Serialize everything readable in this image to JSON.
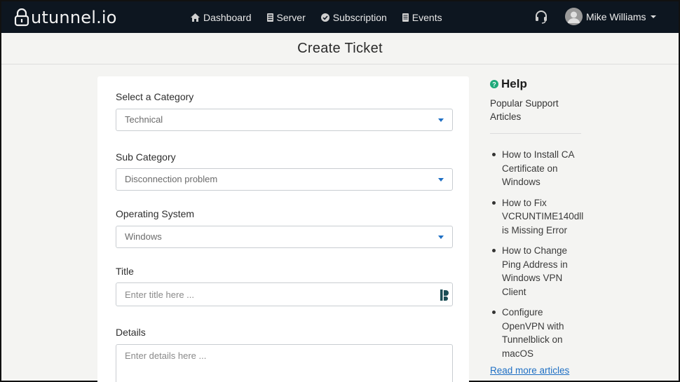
{
  "brand": {
    "logo_text": "utunnel.io"
  },
  "nav": {
    "items": [
      {
        "label": "Dashboard",
        "icon": "home-icon"
      },
      {
        "label": "Server",
        "icon": "server-icon"
      },
      {
        "label": "Subscription",
        "icon": "check-circle-icon"
      },
      {
        "label": "Events",
        "icon": "list-icon"
      }
    ]
  },
  "user": {
    "name": "Mike Williams"
  },
  "page": {
    "title": "Create Ticket"
  },
  "form": {
    "category": {
      "label": "Select a Category",
      "value": "Technical"
    },
    "sub_category": {
      "label": "Sub Category",
      "value": "Disconnection problem"
    },
    "os": {
      "label": "Operating System",
      "value": "Windows"
    },
    "title": {
      "label": "Title",
      "placeholder": "Enter title here ..."
    },
    "details": {
      "label": "Details",
      "placeholder": "Enter details here ..."
    }
  },
  "help": {
    "title": "Help",
    "subtitle": "Popular Support Articles",
    "articles": [
      "How to Install CA Certificate on Windows",
      "How to Fix VCRUNTIME140dll is Missing Error",
      "How to Change Ping Address in Windows VPN Client",
      "Configure OpenVPN with Tunnelblick on macOS"
    ],
    "read_more": "Read more articles"
  },
  "colors": {
    "topbar": "#0d1620",
    "accent": "#1e6fc4",
    "help_icon": "#1fa97a"
  }
}
